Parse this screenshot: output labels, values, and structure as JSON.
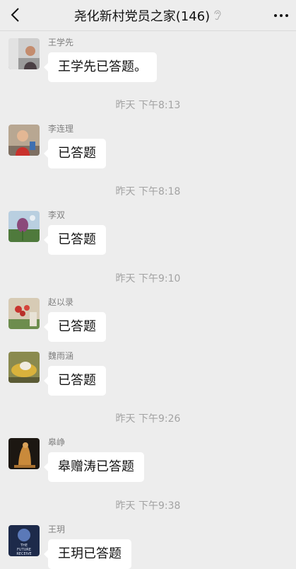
{
  "header": {
    "title": "尧化新村党员之家(146)",
    "back_icon": "chevron-left-icon",
    "mute_icon": "ear-mute-icon",
    "more_icon": "more-dots-icon"
  },
  "messages": [
    {
      "sender": "王学先",
      "text": "王学先已答题。"
    },
    {
      "sender": "李连理",
      "text": "已答题"
    },
    {
      "sender": "李双",
      "text": "已答题"
    },
    {
      "sender": "赵以录",
      "text": "已答题"
    },
    {
      "sender": "魏雨涵",
      "text": "已答题"
    },
    {
      "sender": "皋峥",
      "text": "皋赠涛已答题"
    },
    {
      "sender": "王玥",
      "text": "王玥已答题"
    }
  ],
  "timestamps": [
    "昨天 下午8:13",
    "昨天 下午8:18",
    "昨天 下午9:10",
    "昨天 下午9:26",
    "昨天 下午9:38"
  ],
  "avatar_7_text": [
    "THE",
    "FUTURE",
    "RECEIVE"
  ]
}
